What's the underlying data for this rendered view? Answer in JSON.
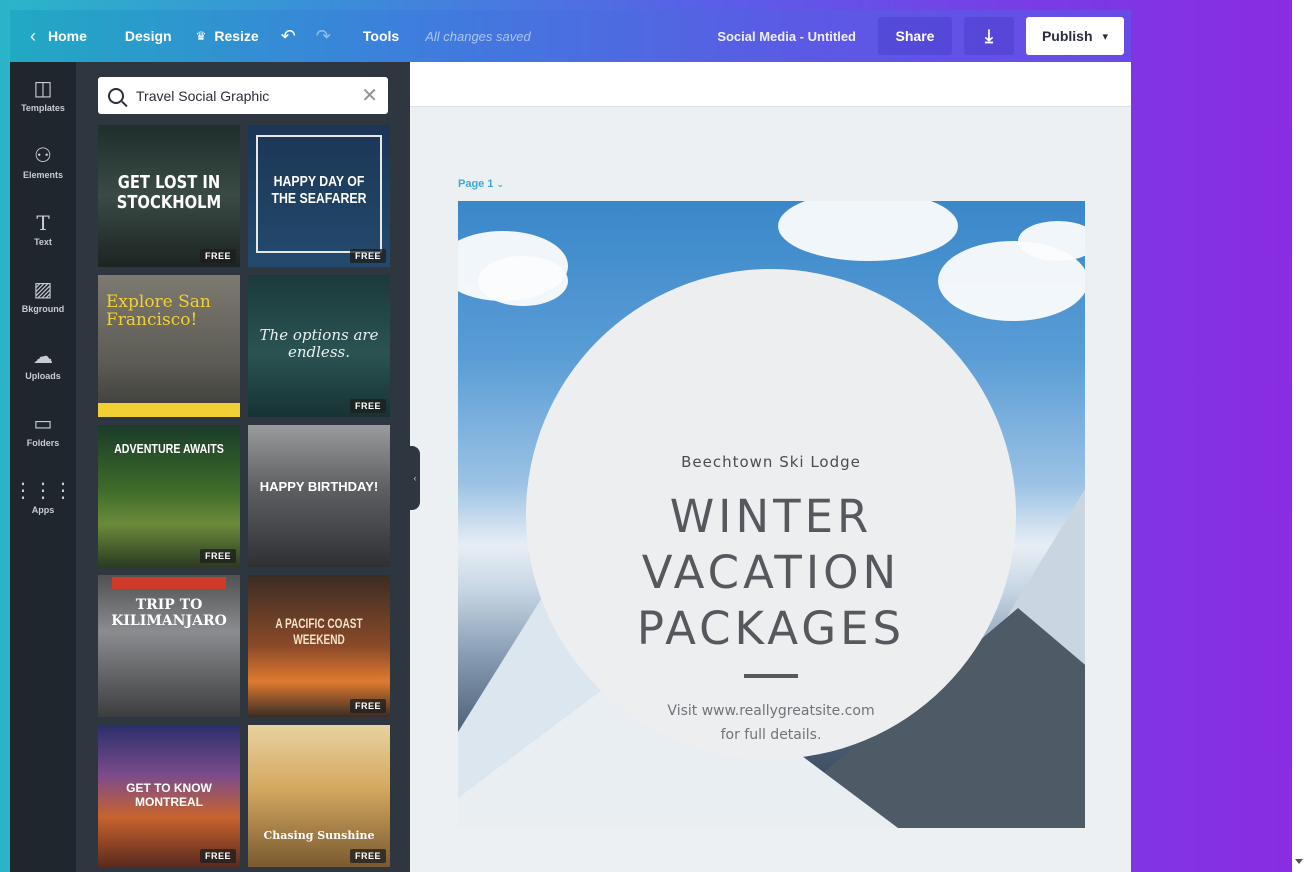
{
  "topbar": {
    "home_label": "Home",
    "design_label": "Design",
    "resize_label": "Resize",
    "tools_label": "Tools",
    "save_status": "All changes saved",
    "doc_title": "Social Media - Untitled",
    "share_label": "Share",
    "publish_label": "Publish"
  },
  "rail": {
    "items": [
      {
        "label": "Templates",
        "icon": "templates-icon"
      },
      {
        "label": "Elements",
        "icon": "elements-icon"
      },
      {
        "label": "Text",
        "icon": "text-icon"
      },
      {
        "label": "Bkground",
        "icon": "background-icon"
      },
      {
        "label": "Uploads",
        "icon": "uploads-icon"
      },
      {
        "label": "Folders",
        "icon": "folders-icon"
      },
      {
        "label": "Apps",
        "icon": "apps-icon"
      }
    ]
  },
  "search": {
    "value": "Travel Social Graphic"
  },
  "templates": [
    {
      "title": "GET LOST IN STOCKHOLM",
      "badge": "FREE"
    },
    {
      "title": "HAPPY DAY OF THE SEAFARER",
      "badge": "FREE"
    },
    {
      "title": "Explore San Francisco!",
      "badge": ""
    },
    {
      "title": "The options are endless.",
      "badge": "FREE"
    },
    {
      "title": "ADVENTURE AWAITS",
      "badge": "FREE"
    },
    {
      "title": "HAPPY BIRTHDAY!",
      "badge": ""
    },
    {
      "title": "TRIP TO KILIMANJARO",
      "badge": ""
    },
    {
      "title": "A PACIFIC COAST WEEKEND",
      "badge": "FREE"
    },
    {
      "title": "GET TO KNOW MONTREAL",
      "badge": "FREE"
    },
    {
      "title": "Chasing Sunshine",
      "badge": "FREE"
    }
  ],
  "workspace": {
    "page_label": "Page 1"
  },
  "design": {
    "lodge": "Beechtown Ski Lodge",
    "line1": "WINTER",
    "line2": "VACATION",
    "line3": "PACKAGES",
    "visit1": "Visit www.reallygreatsite.com",
    "visit2": "for full details."
  },
  "colors": {
    "accent": "#3fa7d1",
    "topbar_start": "#21a9c3",
    "topbar_end": "#6a4ae6",
    "rail_bg": "#1f262e",
    "panel_bg": "#2e3640"
  }
}
